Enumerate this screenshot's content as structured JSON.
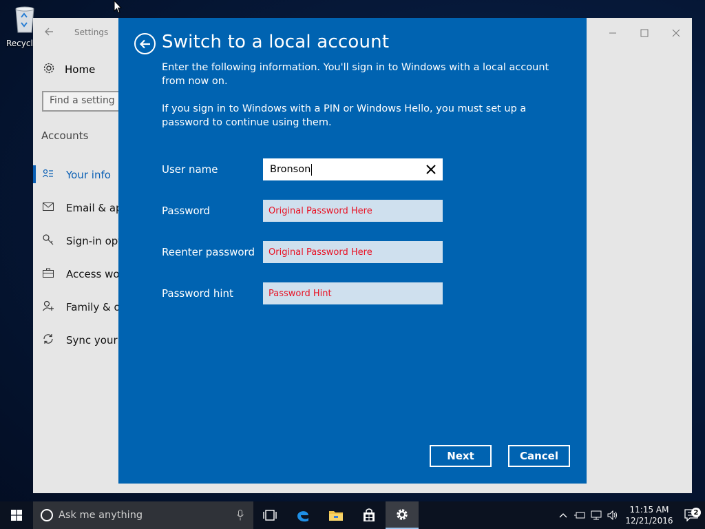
{
  "desktop": {
    "recycle_bin_label": "Recycle"
  },
  "settings_window": {
    "title": "Settings",
    "home_label": "Home",
    "search_placeholder": "Find a setting",
    "section_heading": "Accounts",
    "nav_items": [
      {
        "label": "Your info",
        "icon": "person-list-icon",
        "active": true
      },
      {
        "label": "Email & app",
        "icon": "mail-icon",
        "active": false
      },
      {
        "label": "Sign-in opti",
        "icon": "key-icon",
        "active": false
      },
      {
        "label": "Access work",
        "icon": "briefcase-icon",
        "active": false
      },
      {
        "label": "Family & oth",
        "icon": "person-add-icon",
        "active": false
      },
      {
        "label": "Sync your se",
        "icon": "sync-icon",
        "active": false
      }
    ]
  },
  "dialog": {
    "title": "Switch to a local account",
    "paragraph1": "Enter the following information. You'll sign in to Windows with a local account from now on.",
    "paragraph2": "If you sign in to Windows with a PIN or Windows Hello, you must set up a password to continue using them.",
    "fields": {
      "username": {
        "label": "User name",
        "value": "Bronson"
      },
      "password": {
        "label": "Password",
        "value": "Original Password Here"
      },
      "reenter": {
        "label": "Reenter password",
        "value": "Original Password Here"
      },
      "hint": {
        "label": "Password hint",
        "value": "Password Hint"
      }
    },
    "next_label": "Next",
    "cancel_label": "Cancel",
    "accent_color": "#0063b1"
  },
  "taskbar": {
    "search_placeholder": "Ask me anything",
    "time": "11:15 AM",
    "date": "12/21/2016",
    "notification_count": "2"
  }
}
